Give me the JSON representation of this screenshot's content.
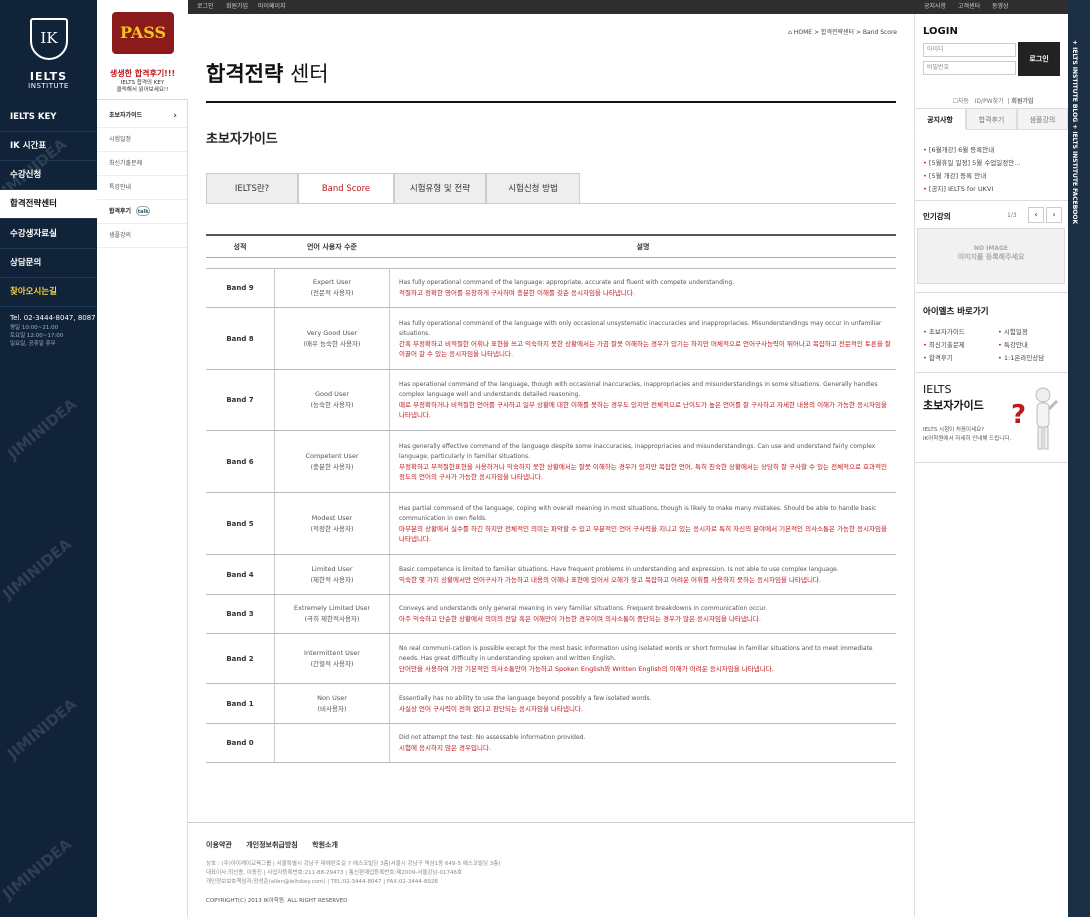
{
  "brand": {
    "name": "IELTS",
    "sub": "INSTITUTE",
    "mark": "IK"
  },
  "topbar": {
    "links": [
      "로그인",
      "회원가입",
      "마이페이지"
    ]
  },
  "right_topbar": {
    "links": [
      "공지사항",
      "고객센터",
      "동영상"
    ]
  },
  "vertical_strip": "+ IELTS INSTITUTE BLOG    + IELTS INSTITUTE FACEBOOK",
  "banner": {
    "badge": "PASS",
    "headline": "생생한 합격후기!!!",
    "sub1": "IELTS 합격의 KEY",
    "sub2": "클릭해서 읽어보세요!!"
  },
  "mainmenu": [
    {
      "label": "IELTS KEY"
    },
    {
      "label": "IK 시간표"
    },
    {
      "label": "수강신청"
    },
    {
      "label": "합격전략센터"
    },
    {
      "label": "수강생자료실"
    },
    {
      "label": "상담문의"
    },
    {
      "label": "찾아오시는길"
    }
  ],
  "contact": {
    "phone": "Tel. 02-3444-8047, 8087",
    "hours1": "평일 10:00~21:00",
    "hours2": "토요일 12:00~17:00",
    "hours3": "일요일, 공휴일 휴무"
  },
  "submenu": [
    "초보자가이드",
    "시험일정",
    "최신기출문제",
    "특강안내",
    "합격후기",
    "샘플강의"
  ],
  "talk_badge": "talk",
  "watermark": "JIMINIDEA",
  "breadcrumb": "HOME > 합격전략센터 > Band Score",
  "page": {
    "title_bold": "합격전략",
    "title_rest": " 센터",
    "section": "초보자가이드"
  },
  "tabs": [
    "IELTS란?",
    "Band Score",
    "시험유형 및 전략",
    "시험신청 방법"
  ],
  "table": {
    "headers": [
      "성적",
      "언어 사용자 수준",
      "설명"
    ],
    "rows": [
      {
        "band": "Band 9",
        "level": "Expert User",
        "level_ko": "(전문적 사용자)",
        "en": "Has fully operational command of the language: appropriate, accurate and fluent with compete understanding.",
        "ko": "적절하고 정확한 영어를 유창하게 구사하며 충분한 이해를 갖춘 응시자임을 나타냅니다."
      },
      {
        "band": "Band 8",
        "level": "Very Good User",
        "level_ko": "(매우 능숙한 사용자)",
        "en": "Has fully operational command of the language with only occasional unsystematic inaccuracies and inappropriacies. Misunderstandings may occur in unfamiliar situations.",
        "ko": "간혹 부정확하고 비적절한 어휘나 표현을 쓰고 익숙하지 못한 상황에서는 가끔 잘못 이해하는 경우가 있기는 하지만 머체적으로 언어구사능력이 뛰어나고 복잡하고 전문적인 토론을 잘 이끌어 갈 수 있는 응시자임을 나타냅니다."
      },
      {
        "band": "Band 7",
        "level": "Good User",
        "level_ko": "(능숙한 사용자)",
        "en": "Has operational command of the language, though with occasional inaccuracies, inappropriacies and misunderstandings in some situations. Generally handles complex language well and understands detailed reasoning.",
        "ko": "때로 부정확하거나 비적절한 언어를 구사하고 일부 상황에 대한 이해를 못하는 경우도 있지만 전체적으로 난이도가 높은 언어를 잘 구사하고 자세한 내용의 이해가 가능한 응시자임을 나타냅니다."
      },
      {
        "band": "Band 6",
        "level": "Competent User",
        "level_ko": "(충분한 사용자)",
        "en": "Has generally effective command of the language despite some inaccuracies, inappropriacies and misunderstandings. Can use and understand fairly complex language, particularly in familiar situations.",
        "ko": "부정확하고 부적절한표현을 사용하거나 익숙하지 못한 상황에서는 잘못 이해하는 경우가 있지만 복잡한 언어, 특히 친숙한 상황에서는 상당히 잘 구사할 수 있는 전체적으로 효과적인 정도의 언어의 구사가 가능한 응시자임을 나타냅니다."
      },
      {
        "band": "Band 5",
        "level": "Modest User",
        "level_ko": "(적정한 사용자)",
        "en": "Has partial command of the language, coping with overall meaning in most situations, though is likely to make many mistakes. Should be able to handle basic communication in own fields.",
        "ko": "마부분의 상황에서 실수를 하긴 하지만 전체적인 의미는 파악할 수 있고 부분적인 언어 구사력을 지니고 있는 응시자로 특히 자신의 분야에서 기본적인 의사소통은 가능한 응시자임을 나타냅니다."
      },
      {
        "band": "Band 4",
        "level": "Limited User",
        "level_ko": "(제한적 사용자)",
        "en": "Basic competence is limited to familiar situations. Have frequent problems in understanding and expression. Is not able to use complex language.",
        "ko": "익숙한 몇 가지 상황에서만 언어구사가 가능하고 내용의 이해나 표현에 있어서 오해가 잦고 복잡하고 어려운 어휘를 사용하지 못하는 응시자임을 나타냅니다."
      },
      {
        "band": "Band 3",
        "level": "Extremely Limited User",
        "level_ko": "(극히 제한적사용자)",
        "en": "Conveys and understands only general meaning in very familiar situations. Frequent breakdowns in communication occur.",
        "ko": "아주 익숙하고 단순한 상황에서 의미의 전달 혹은 이해만이 가능한 경우이며 의사소통이 중단되는 경우가 많은 응시자임을 나타냅니다."
      },
      {
        "band": "Band 2",
        "level": "Intermittent User",
        "level_ko": "(간헐적 사용자)",
        "en": "No real communi-cation is possible except for the most basic information using isolated words or short formulae in familiar situations and to meet immediate needs. Has great difficulty in understanding spoken and written English.",
        "ko": "단어만을 사용하여 가장 기본적인 의사소통만이 가능하고 Spoken English와 Written English의 이해가 어려운 응시자임을 나타냅니다."
      },
      {
        "band": "Band 1",
        "level": "Non User",
        "level_ko": "(비사용자)",
        "en": "Essentially has no ability to use the language beyond possibly a few isolated words.",
        "ko": "사실상 언어 구사력이 전혀 없다고 판단되는 응시자임을 나타냅니다."
      },
      {
        "band": "Band 0",
        "level": "",
        "level_ko": "",
        "en": "Did not attempt the test: No assessable information provided.",
        "ko": "시험에 응시하지 않은 경우입니다."
      }
    ]
  },
  "footer": {
    "links": [
      "이용약관",
      "개인정보취급방침",
      "학원소개"
    ],
    "addr1": "상호 : (주)아이케이교육그룹 | 서울특별시 강남구 테헤란로길 7 에스코빌딩 3층(서울시 강남구 역삼1동 649-5 에스코빌딩 3층)",
    "addr2": "대표이사:최선종, 이동진 | 사업자등록번호:211-88-29473 | 통신판매업등록번호:제2009-서울강남-01746호",
    "addr3": "개인정보보호책임자:양성준(allen@ieltskey.com) | TEL:02-3444-8047 | FAX:02-3444-8928",
    "copy": "COPYRIGHT(C) 2013 IK아학원. ALL RIGHT RESERVED"
  },
  "login": {
    "title": "LOGIN",
    "id_placeholder": "아이디",
    "pw_placeholder": "비밀번호",
    "button": "로그인",
    "auto": "자동",
    "find": "ID/PW찾기",
    "join": "회원가입"
  },
  "notice_tabs": [
    "공지사항",
    "합격후기",
    "샘플강의"
  ],
  "notices": [
    "[6월개강] 6월 등록안내",
    "[5월휴일 일정] 5월 수업일정안…",
    "[5월 개강] 등록 안내",
    "[공지] IELTS for UKVI"
  ],
  "popular": {
    "title": "인기강의",
    "page": "1/3",
    "noimg1": "NO IMAGE",
    "noimg2": "이미지를 등록해주세요"
  },
  "quicklinks": {
    "title": "아이엘츠 바로가기",
    "items": [
      "초보자가이드",
      "시험일정",
      "최신기출문제",
      "특강안내",
      "합격후기",
      "1:1온라인상담"
    ]
  },
  "guide": {
    "t1": "IELTS",
    "t2": "초보자가이드",
    "d1": "IELTS 시험이 처음이세요?",
    "d2": "IK어학원에서 자세히 안내해 드립니다."
  }
}
